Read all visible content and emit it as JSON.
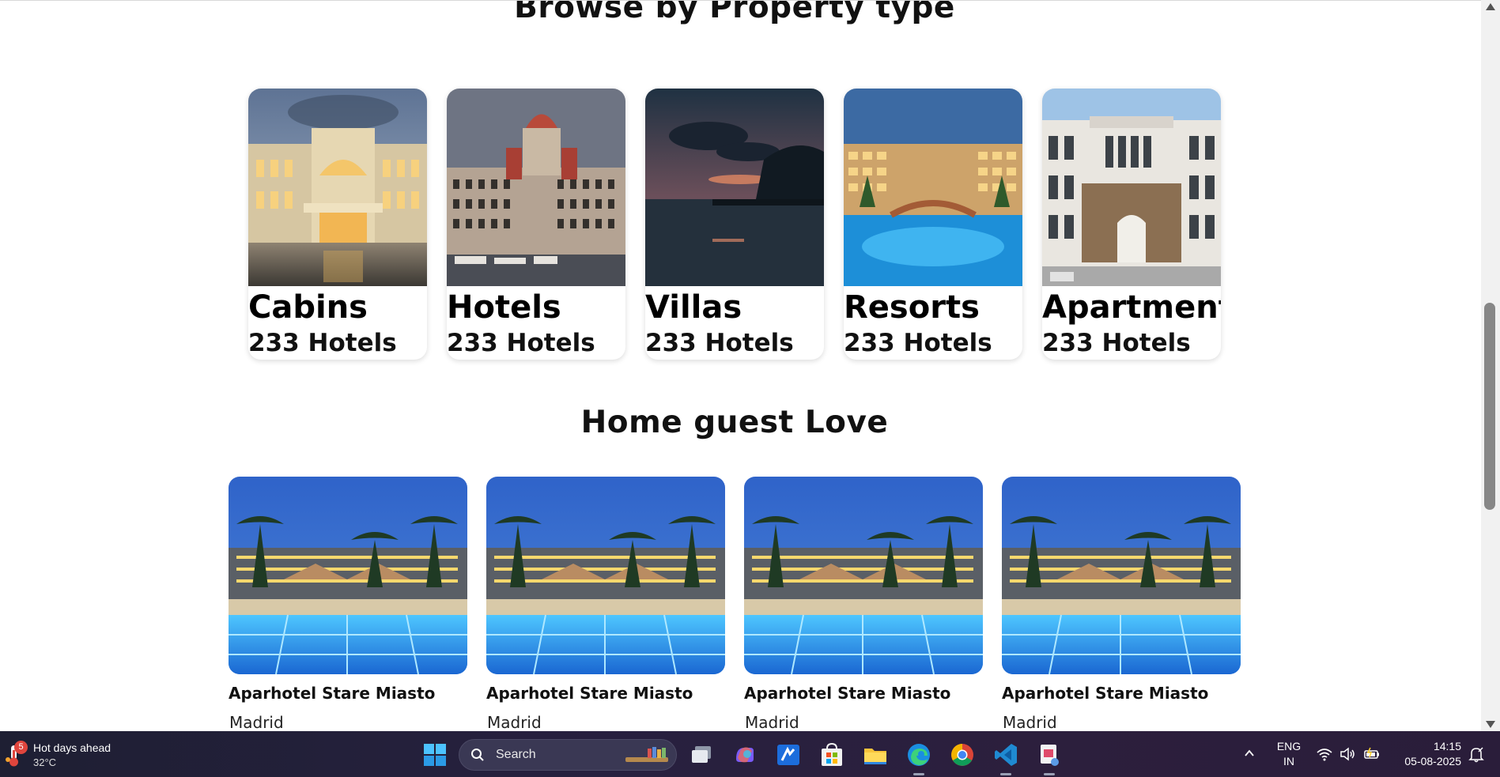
{
  "sections": {
    "property_title": "Browse by Property type",
    "love_title": "Home guest Love"
  },
  "property_types": [
    {
      "name": "Cabins",
      "count": "233 Hotels"
    },
    {
      "name": "Hotels",
      "count": "233 Hotels"
    },
    {
      "name": "Villas",
      "count": "233 Hotels"
    },
    {
      "name": "Resorts",
      "count": "233 Hotels"
    },
    {
      "name": "Apartment",
      "count": "233 Hotels"
    }
  ],
  "hotels": [
    {
      "name": "Aparhotel Stare Miasto",
      "city": "Madrid"
    },
    {
      "name": "Aparhotel Stare Miasto",
      "city": "Madrid"
    },
    {
      "name": "Aparhotel Stare Miasto",
      "city": "Madrid"
    },
    {
      "name": "Aparhotel Stare Miasto",
      "city": "Madrid"
    }
  ],
  "taskbar": {
    "weather": {
      "title": "Hot days ahead",
      "temp": "32°C",
      "badge": "5",
      "icon": "thermometer-icon"
    },
    "search_label": "Search",
    "apps": [
      "windows-start-icon",
      "search-icon",
      "task-view-icon",
      "copilot-icon",
      "news-app-icon",
      "microsoft-store-icon",
      "file-explorer-icon",
      "edge-icon",
      "chrome-icon",
      "vscode-icon",
      "snipping-tool-icon"
    ],
    "tray": {
      "lang_line1": "ENG",
      "lang_line2": "IN",
      "time": "14:15",
      "date": "05-08-2025"
    }
  },
  "colors": {
    "taskbar_bg": "#27203f",
    "scroll_thumb": "#878787"
  }
}
